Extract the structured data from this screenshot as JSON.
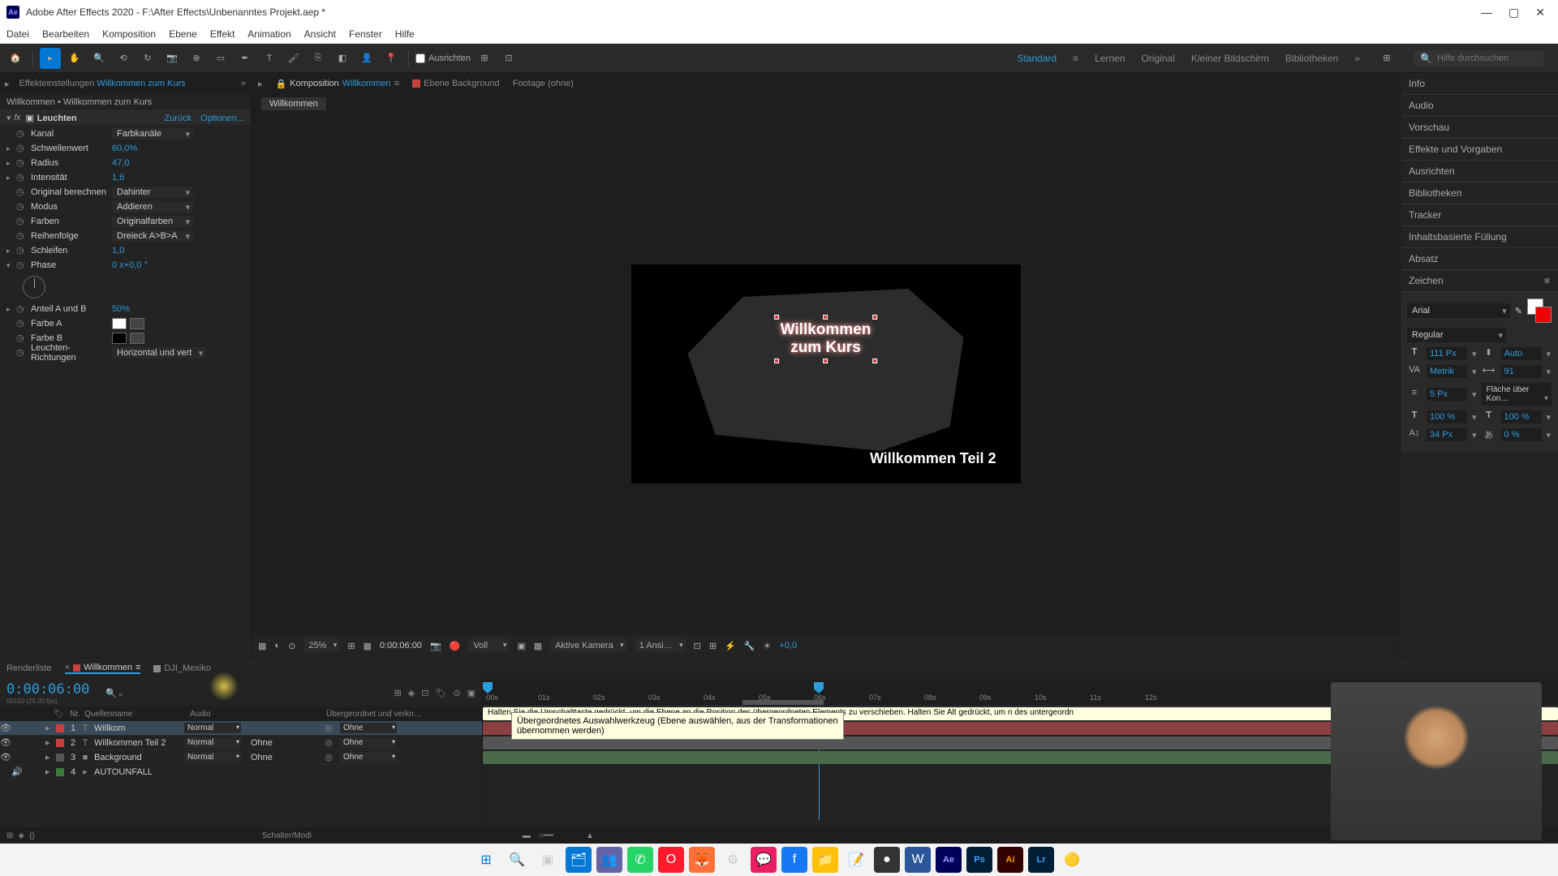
{
  "titlebar": {
    "title": "Adobe After Effects 2020 - F:\\After Effects\\Unbenanntes Projekt.aep *"
  },
  "menubar": {
    "items": [
      "Datei",
      "Bearbeiten",
      "Komposition",
      "Ebene",
      "Effekt",
      "Animation",
      "Ansicht",
      "Fenster",
      "Hilfe"
    ]
  },
  "toolbar": {
    "align_label": "Ausrichten",
    "workspaces": [
      "Standard",
      "Lernen",
      "Original",
      "Kleiner Bildschirm",
      "Bibliotheken"
    ],
    "search_placeholder": "Hilfe durchsuchen"
  },
  "effect_panel": {
    "tab1": "Effekteinstellungen",
    "tab1_name": "Willkommen zum Kurs",
    "breadcrumb": "Willkommen • Willkommen zum Kurs",
    "fx_name": "Leuchten",
    "link_back": "Zurück",
    "link_opts": "Optionen...",
    "props": {
      "kanal_label": "Kanal",
      "kanal_value": "Farbkanäle",
      "schwellen_label": "Schwellenwert",
      "schwellen_value": "60,0%",
      "radius_label": "Radius",
      "radius_value": "47,0",
      "intensitat_label": "Intensität",
      "intensitat_value": "1,6",
      "original_label": "Original berechnen",
      "original_value": "Dahinter",
      "modus_label": "Modus",
      "modus_value": "Addieren",
      "farben_label": "Farben",
      "farben_value": "Originalfarben",
      "reihen_label": "Reihenfolge",
      "reihen_value": "Dreieck A>B>A",
      "schleifen_label": "Schleifen",
      "schleifen_value": "1,0",
      "phase_label": "Phase",
      "phase_value": "0 x+0,0 °",
      "anteil_label": "Anteil A und B",
      "anteil_value": "50%",
      "farbeA_label": "Farbe A",
      "farbeB_label": "Farbe B",
      "richtungen_label": "Leuchten-Richtungen",
      "richtungen_value": "Horizontal und vert"
    }
  },
  "comp_panel": {
    "tab_comp_prefix": "Komposition",
    "tab_comp_name": "Willkommen",
    "tab_layer": "Ebene Background",
    "tab_footage": "Footage (ohne)",
    "crumb": "Willkommen",
    "text_line1": "Willkommen",
    "text_line2": "zum Kurs",
    "text_2": "Willkommen Teil 2"
  },
  "viewer_controls": {
    "zoom": "25%",
    "time": "0:00:06:00",
    "res": "Voll",
    "camera": "Aktive Kamera",
    "views": "1 Ansi…",
    "exposure": "+0,0"
  },
  "right_panel": {
    "sections": [
      "Info",
      "Audio",
      "Vorschau",
      "Effekte und Vorgaben",
      "Ausrichten",
      "Bibliotheken",
      "Tracker",
      "Inhaltsbasierte Füllung",
      "Absatz"
    ],
    "char_title": "Zeichen",
    "font": "Arial",
    "style": "Regular",
    "size": "111 Px",
    "leading": "Auto",
    "kerning": "Metrik",
    "tracking": "91",
    "stroke": "5 Px",
    "stroke_mode": "Fläche über Kon…",
    "vscale": "100 %",
    "hscale": "100 %",
    "baseline": "34 Px",
    "tsume": "0 %"
  },
  "timeline": {
    "tab_render": "Renderliste",
    "tab_comp": "Willkommen",
    "tab_dji": "DJI_Mexiko",
    "timecode": "0:00:06:00",
    "framerate": "00150 (25.00 fps)",
    "col_nr": "Nr.",
    "col_quelle": "Quellenname",
    "col_audio": "Audio",
    "col_parent": "Übergeordnet und verkn…",
    "mode_normal": "Normal",
    "track_none": "Ohne",
    "layers": [
      {
        "num": "1",
        "name": "Willkom",
        "color": "#c94040",
        "type": "T"
      },
      {
        "num": "2",
        "name": "Willkommen Teil 2",
        "color": "#c94040",
        "type": "T"
      },
      {
        "num": "3",
        "name": "Background",
        "color": "#555",
        "type": "■"
      },
      {
        "num": "4",
        "name": "AUTOUNFALL",
        "color": "#3a7a3a",
        "type": "▸"
      }
    ],
    "ruler_ticks": [
      ":00s",
      "01s",
      "02s",
      "03s",
      "04s",
      "05s",
      "06s",
      "07s",
      "08s",
      "09s",
      "10s",
      "11s",
      "12s"
    ],
    "tooltip_bar": "Halten Sie die Umschalttaste gedrückt, um die Ebene an die Position des übergeordneten Elements zu verschieben. Halten Sie Alt gedrückt, um             n des untergeordn",
    "tooltip_box": "Übergeordnetes Auswahlwerkzeug (Ebene auswählen, aus der Transformationen übernommen werden)",
    "footer": "Schalter/Modi"
  },
  "taskbar": {
    "icons": [
      "win",
      "search",
      "tasks",
      "explorer",
      "teams",
      "whatsapp",
      "opera",
      "firefox",
      "app1",
      "messenger",
      "facebook",
      "folder",
      "note",
      "obs",
      "word",
      "ae",
      "ps",
      "ai",
      "lr",
      "misc"
    ]
  }
}
